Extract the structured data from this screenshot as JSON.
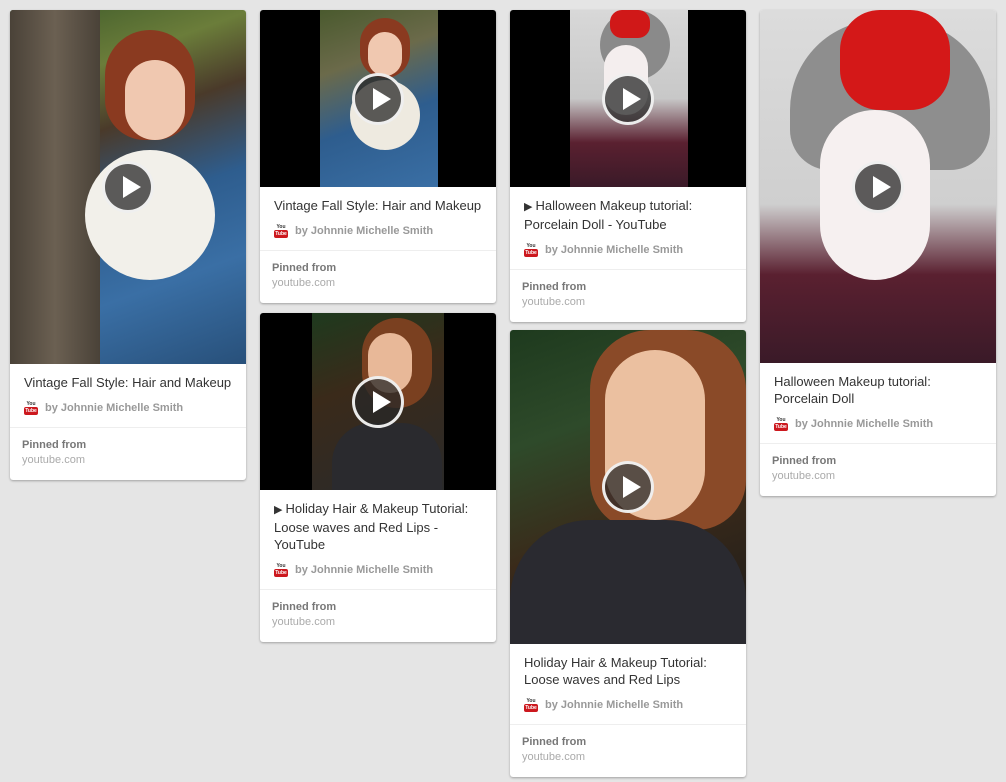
{
  "pins": [
    {
      "title": "Vintage Fall Style: Hair and Makeup",
      "author": "by Johnnie Michelle Smith",
      "pinned_from_label": "Pinned from",
      "domain": "youtube.com",
      "source_icon": "youtube-icon"
    },
    {
      "title": "Vintage Fall Style: Hair and Makeup",
      "author": "by Johnnie Michelle Smith",
      "pinned_from_label": "Pinned from",
      "domain": "youtube.com",
      "source_icon": "youtube-icon"
    },
    {
      "title": "Holiday Hair & Makeup Tutorial: Loose waves and Red Lips - YouTube",
      "author": "by Johnnie Michelle Smith",
      "pinned_from_label": "Pinned from",
      "domain": "youtube.com",
      "source_icon": "youtube-icon"
    },
    {
      "title": "Halloween Makeup tutorial: Porcelain Doll - YouTube",
      "author": "by Johnnie Michelle Smith",
      "pinned_from_label": "Pinned from",
      "domain": "youtube.com",
      "source_icon": "youtube-icon"
    },
    {
      "title": "Holiday Hair & Makeup Tutorial: Loose waves and Red Lips",
      "author": "by Johnnie Michelle Smith",
      "pinned_from_label": "Pinned from",
      "domain": "youtube.com",
      "source_icon": "youtube-icon"
    },
    {
      "title": "Halloween Makeup tutorial: Porcelain Doll",
      "author": "by Johnnie Michelle Smith",
      "pinned_from_label": "Pinned from",
      "domain": "youtube.com",
      "source_icon": "youtube-icon"
    }
  ],
  "youtube_icon": {
    "top": "You",
    "bottom": "Tube"
  },
  "play_glyph": "▶",
  "colors": {
    "background": "#e5e5e5",
    "card": "#ffffff",
    "youtube_red": "#cc181e",
    "muted_text": "#999999"
  }
}
